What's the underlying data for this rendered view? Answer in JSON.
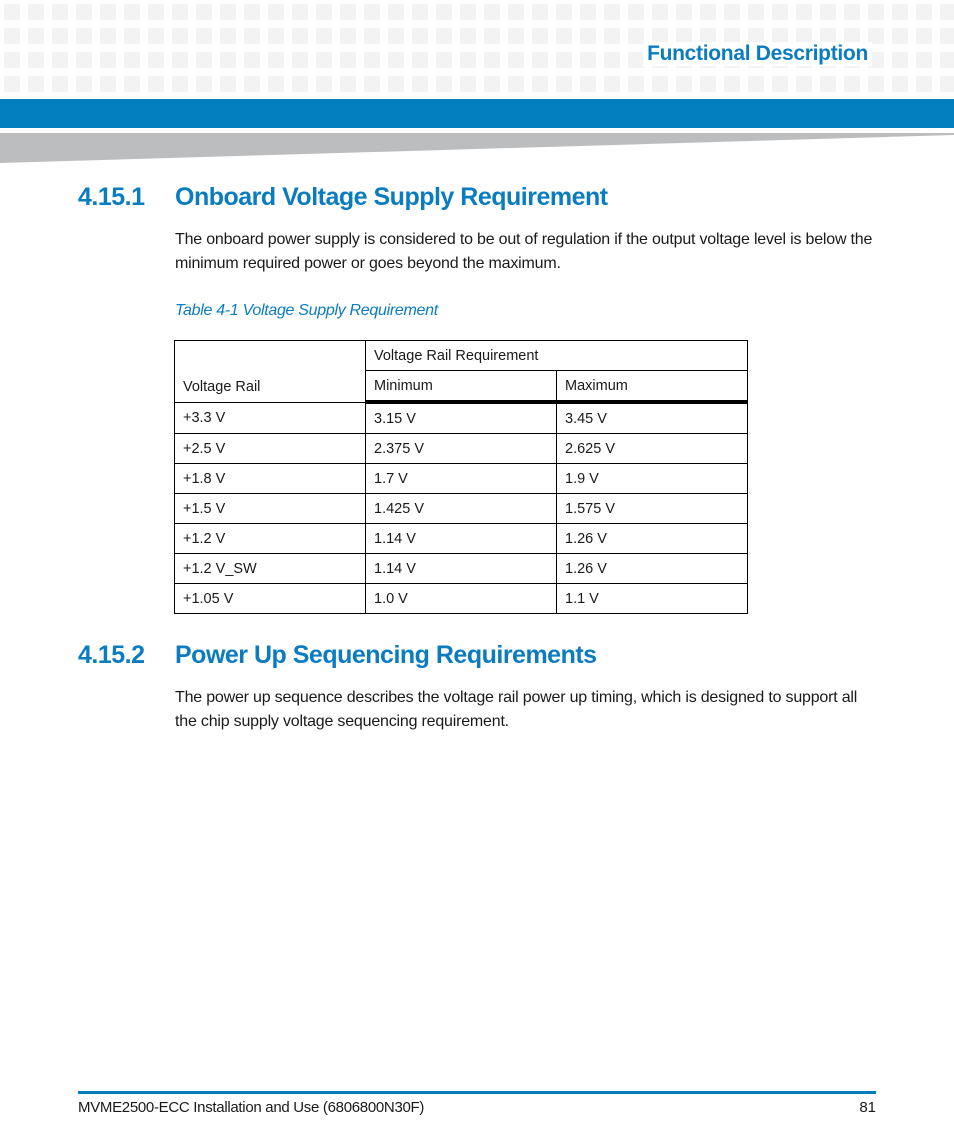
{
  "header": {
    "section_title": "Functional Description"
  },
  "sections": [
    {
      "number": "4.15.1",
      "title": "Onboard Voltage Supply Requirement",
      "body": "The onboard power supply is considered to be out of regulation if the output voltage level is below the minimum required power or goes beyond the maximum."
    },
    {
      "number": "4.15.2",
      "title": "Power Up Sequencing Requirements",
      "body": "The power up sequence describes the voltage rail power up timing, which is designed to support all the chip supply voltage sequencing requirement."
    }
  ],
  "table": {
    "caption": "Table 4-1 Voltage Supply Requirement",
    "header_rail": "Voltage Rail",
    "header_group": "Voltage Rail Requirement",
    "header_min": "Minimum",
    "header_max": "Maximum",
    "rows": [
      {
        "rail": "+3.3 V",
        "min": "3.15 V",
        "max": "3.45 V"
      },
      {
        "rail": "+2.5 V",
        "min": "2.375 V",
        "max": "2.625 V"
      },
      {
        "rail": "+1.8 V",
        "min": "1.7 V",
        "max": "1.9 V"
      },
      {
        "rail": "+1.5 V",
        "min": "1.425 V",
        "max": "1.575 V"
      },
      {
        "rail": "+1.2 V",
        "min": "1.14 V",
        "max": "1.26 V"
      },
      {
        "rail": "+1.2 V_SW",
        "min": "1.14 V",
        "max": "1.26 V"
      },
      {
        "rail": "+1.05 V",
        "min": "1.0 V",
        "max": "1.1 V"
      }
    ]
  },
  "footer": {
    "document": "MVME2500-ECC Installation and Use (6806800N30F)",
    "page_number": "81"
  },
  "colors": {
    "accent_blue": "#027dbe",
    "heading_blue": "#0a7cbf",
    "pattern_gray": "#f3f3f3",
    "wedge_gray": "#bcbdbf"
  }
}
